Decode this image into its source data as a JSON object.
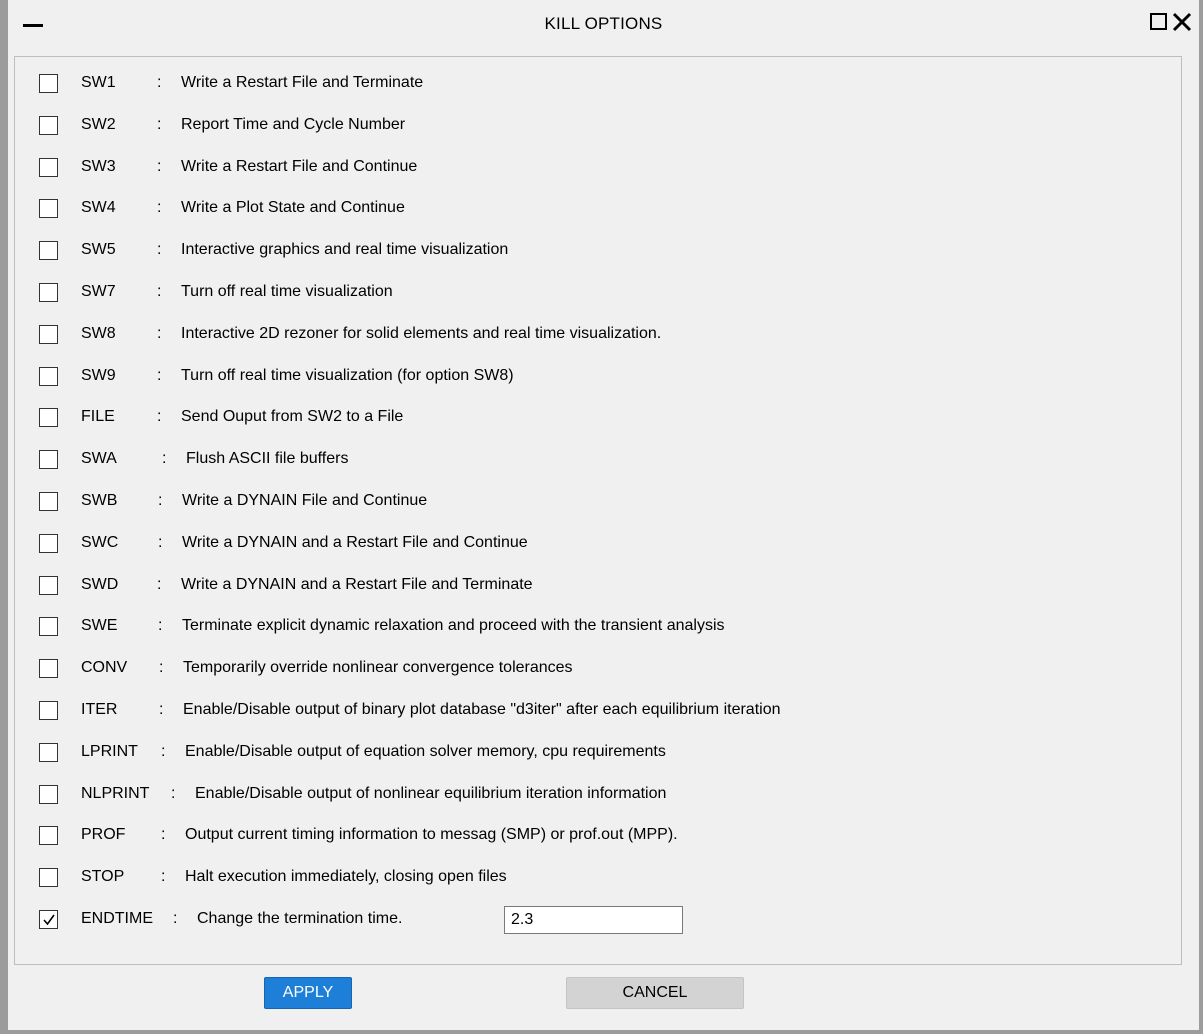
{
  "window": {
    "title": "KILL OPTIONS"
  },
  "options": [
    {
      "key": "SW1",
      "desc": "Write a Restart File and Terminate",
      "checked": false
    },
    {
      "key": "SW2",
      "desc": "Report Time and Cycle Number",
      "checked": false
    },
    {
      "key": "SW3",
      "desc": "Write a Restart File and Continue",
      "checked": false
    },
    {
      "key": "SW4",
      "desc": "Write a Plot State and Continue",
      "checked": false
    },
    {
      "key": "SW5",
      "desc": "Interactive graphics and real time visualization",
      "checked": false
    },
    {
      "key": "SW7",
      "desc": "Turn off real time visualization",
      "checked": false
    },
    {
      "key": "SW8",
      "desc": "Interactive 2D rezoner for solid elements and real time visualization.",
      "checked": false
    },
    {
      "key": "SW9",
      "desc": "Turn off real time visualization (for option SW8)",
      "checked": false
    },
    {
      "key": "FILE",
      "desc": "Send Ouput from SW2 to a File",
      "checked": false
    },
    {
      "key": "SWA",
      "desc": "Flush ASCII file buffers",
      "checked": false
    },
    {
      "key": "SWB",
      "desc": "Write a DYNAIN File and Continue",
      "checked": false
    },
    {
      "key": "SWC",
      "desc": "Write a DYNAIN and a Restart File and Continue",
      "checked": false
    },
    {
      "key": "SWD",
      "desc": "Write a DYNAIN and a Restart File and Terminate",
      "checked": false
    },
    {
      "key": "SWE",
      "desc": "Terminate explicit dynamic relaxation and proceed with the transient analysis",
      "checked": false
    },
    {
      "key": "CONV",
      "desc": "Temporarily override nonlinear convergence tolerances",
      "checked": false
    },
    {
      "key": "ITER",
      "desc": "Enable/Disable output of binary plot database \"d3iter\" after each equilibrium iteration",
      "checked": false
    },
    {
      "key": "LPRINT",
      "desc": "Enable/Disable output of equation solver memory, cpu requirements",
      "checked": false
    },
    {
      "key": "NLPRINT",
      "desc": "Enable/Disable output of nonlinear equilibrium iteration information",
      "checked": false
    },
    {
      "key": "PROF",
      "desc": "Output current timing information to messag (SMP) or prof.out (MPP).",
      "checked": false
    },
    {
      "key": "STOP",
      "desc": "Halt execution immediately, closing open files",
      "checked": false
    },
    {
      "key": "ENDTIME",
      "desc": "Change the termination time.",
      "checked": true
    }
  ],
  "separator": ":",
  "endtime_value": "2.3",
  "buttons": {
    "apply": "APPLY",
    "cancel": "CANCEL"
  },
  "colors": {
    "apply_bg": "#1e7fd8",
    "cancel_bg": "#d3d3d3"
  }
}
